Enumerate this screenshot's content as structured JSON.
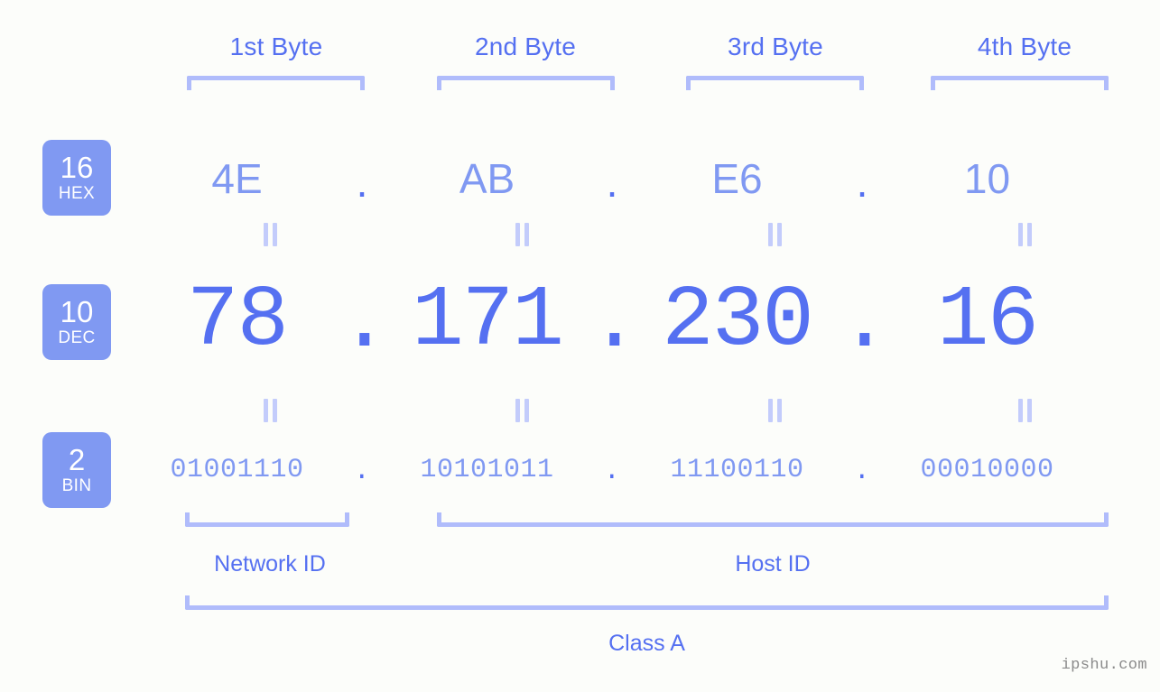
{
  "background_color": "#fcfdfa",
  "accent_color": "#5570f1",
  "accent_light_color": "#8099f2",
  "bracket_color": "#b0bcfb",
  "badge_color": "#8099f2",
  "byte_headers": [
    {
      "label": "1st Byte"
    },
    {
      "label": "2nd Byte"
    },
    {
      "label": "3rd Byte"
    },
    {
      "label": "4th Byte"
    }
  ],
  "rows": {
    "hex": {
      "badge_number": "16",
      "badge_name": "HEX",
      "octets": [
        "4E",
        "AB",
        "E6",
        "10"
      ],
      "separator": "."
    },
    "dec": {
      "badge_number": "10",
      "badge_name": "DEC",
      "octets": [
        "78",
        "171",
        "230",
        "16"
      ],
      "separator": "."
    },
    "bin": {
      "badge_number": "2",
      "badge_name": "BIN",
      "octets": [
        "01001110",
        "10101011",
        "11100110",
        "00010000"
      ],
      "separator": "."
    }
  },
  "segments": {
    "network_id": "Network ID",
    "host_id": "Host ID",
    "class": "Class A"
  },
  "watermark": "ipshu.com"
}
